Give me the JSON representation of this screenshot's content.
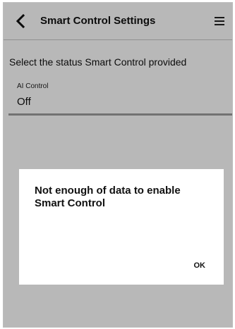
{
  "header": {
    "title": "Smart Control Settings",
    "back_icon": "chevron-left-icon",
    "menu_icon": "hamburger-menu-icon"
  },
  "subtitle": "Select the status Smart Control provided",
  "setting": {
    "label": "AI Control",
    "value": "Off"
  },
  "dialog": {
    "message": "Not enough of data to enable Smart Control",
    "ok_label": "OK"
  },
  "colors": {
    "overlay": "#b9b9b9",
    "text": "#111111"
  }
}
